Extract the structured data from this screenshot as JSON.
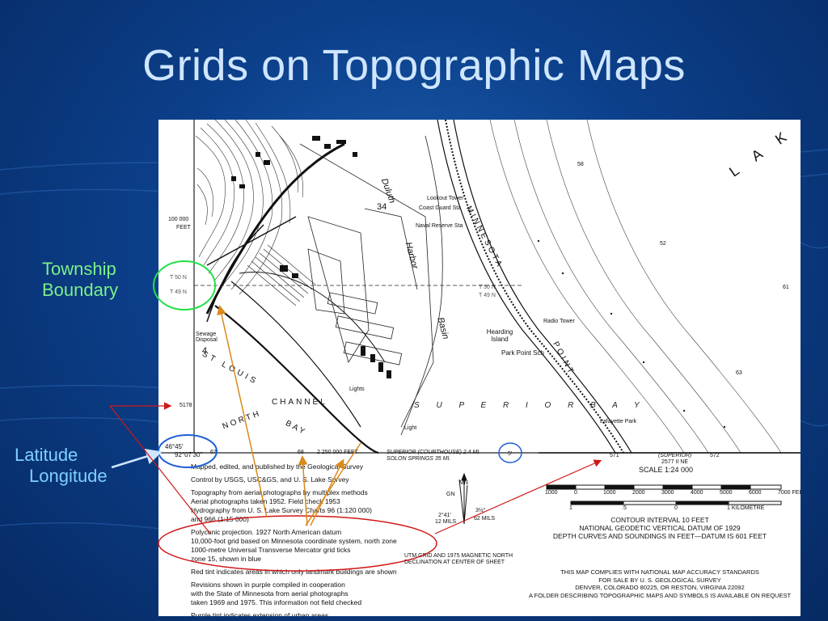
{
  "slide": {
    "title": "Grids on Topographic Maps"
  },
  "labels": {
    "township": [
      "Township",
      "Boundary"
    ],
    "latlong": [
      "Latitude",
      "Longitude"
    ]
  },
  "map": {
    "place_labels": {
      "lake": "L A K",
      "duluth": "Duluth",
      "harbor": "Harbor",
      "basin": "Basin",
      "superior_bay": "S U P E R I O R   B A Y",
      "st_louis": "ST LOUIS",
      "north": "NORTH",
      "channel": "CHANNEL",
      "bay": "BAY",
      "minnesota": "MINNESOTA",
      "point": "POINT",
      "hearding_island": "Hearding Island",
      "park_point": "Park Point Sch",
      "coast_guard": "Coast Guard Sta",
      "naval_reserve": "Naval Reserve Sta",
      "lookout_tower": "Lookout Tower",
      "radio_tower": "Radio Tower",
      "lafayette_park": "Lafayette Park",
      "sewage": "Sewage Disposal",
      "light": "Light",
      "lights": "Lights",
      "section_34": "34",
      "section_4": "4"
    },
    "grid_labels": {
      "feet_100000": "100 000",
      "feet_label": "FEET",
      "t50n_left": "T 50 N",
      "t49n_left": "T 49 N",
      "t50n_right": "T 50 N",
      "t49n_right": "T 49 N",
      "lat": "46°45′",
      "lon": "92°07′30″",
      "tick_5178": "5178",
      "tick_67": "67",
      "tick_68": "68",
      "feet_2250000": "2 250 000 FEET",
      "courthouse": "SUPERIOR (COURTHOUSE) 2.4 MI.",
      "solon": "SOLON SPRINGS 35 MI.",
      "tick_5": "5′",
      "tick_571": "571",
      "tick_572": "572",
      "superior_sheet": "(SUPERIOR)",
      "sheet_id": "2577 II NE",
      "depth_58": "58",
      "depth_52": "52",
      "depth_61": "61",
      "depth_63": "63"
    },
    "notes": [
      "Mapped, edited, and published by the Geological Survey",
      "",
      "Control by USGS, USC&GS, and U. S. Lake Survey",
      "",
      "Topography from aerial photographs by multiplex methods",
      "Aerial photographs taken 1952.   Field check 1953",
      "Hydrography from U. S. Lake Survey Charts 96 (1:120 000)",
      "and 966 (1:15 000)",
      "",
      "Polyconic projection.   1927 North American datum",
      "10,000-foot grid based on Minnesota coordinate system, north zone",
      "1000-metre Universal Transverse Mercator grid ticks",
      "zone 15, shown in blue",
      "",
      "Red tint indicates areas in which only landmark buildings are shown",
      "",
      "Revisions shown in purple compiled in cooperation",
      "with the State of Minnesota from aerial photographs",
      "taken 1969 and 1975.    This information not field checked",
      "",
      "Purple tint indicates extension of urban areas"
    ],
    "declination": {
      "mn": "MN",
      "gn": "GN",
      "left_angle": "2°41′",
      "left_mils": "12 MILS",
      "right_angle": "3½°",
      "right_mils": "62 MILS",
      "caption1": "UTM GRID AND 1975 MAGNETIC NORTH",
      "caption2": "DECLINATION AT CENTER OF SHEET"
    },
    "scale": {
      "title": "SCALE  1:24 000",
      "feet_ticks": [
        "1000",
        "0",
        "1000",
        "2000",
        "3000",
        "4000",
        "5000",
        "6000",
        "7000 FEET"
      ],
      "km_ticks": [
        "1",
        ".5",
        "0",
        "1 KILOMETRE"
      ]
    },
    "contour": [
      "CONTOUR INTERVAL 10 FEET",
      "NATIONAL GEODETIC VERTICAL DATUM OF 1929",
      "DEPTH CURVES AND SOUNDINGS IN FEET—DATUM IS 601 FEET"
    ],
    "compliance": [
      "THIS MAP COMPLIES WITH NATIONAL MAP ACCURACY STANDARDS",
      "FOR SALE BY U. S. GEOLOGICAL SURVEY",
      "DENVER, COLORADO 80225, OR RESTON, VIRGINIA 22092",
      "A FOLDER DESCRIBING TOPOGRAPHIC MAPS AND SYMBOLS IS AVAILABLE ON REQUEST"
    ],
    "colors": {
      "annotation_green": "#22e04a",
      "annotation_blue": "#1e5fd6",
      "annotation_orange": "#d98a1a",
      "annotation_red": "#d01818"
    }
  }
}
